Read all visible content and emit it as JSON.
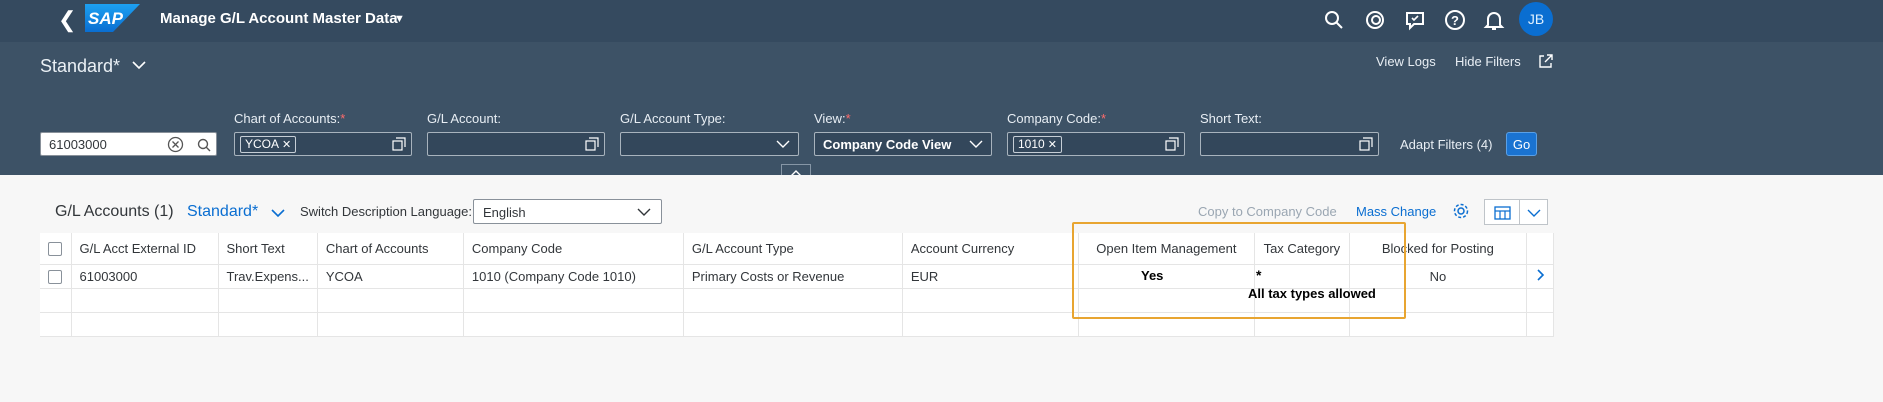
{
  "shell": {
    "title": "Manage G/L Account Master Data",
    "logo_text": "SAP",
    "avatar_initials": "JB",
    "icons": [
      "search-icon",
      "copilot-icon",
      "feedback-icon",
      "help-icon",
      "notification-icon"
    ]
  },
  "filterbar": {
    "variant": "Standard*",
    "view_logs": "View Logs",
    "hide_filters": "Hide Filters",
    "search_value": "61003000",
    "filters": {
      "chart_of_accounts": {
        "label": "Chart of Accounts:",
        "required": "*",
        "token": "YCOA"
      },
      "gl_account": {
        "label": "G/L Account:"
      },
      "gl_account_type": {
        "label": "G/L Account Type:"
      },
      "view": {
        "label": "View:",
        "required": "*",
        "value": "Company Code View"
      },
      "company_code": {
        "label": "Company Code:",
        "required": "*",
        "token": "1010"
      },
      "short_text": {
        "label": "Short Text:"
      }
    },
    "adapt_filters": "Adapt Filters (4)",
    "go": "Go"
  },
  "table_toolbar": {
    "title": "G/L Accounts (1)",
    "variant": "Standard*",
    "lang_label": "Switch Description Language:",
    "lang_value": "English",
    "copy_to_company_code": "Copy to Company Code",
    "mass_change": "Mass Change"
  },
  "table": {
    "columns": [
      "G/L Acct External ID",
      "Short Text",
      "Chart of Accounts",
      "Company Code",
      "G/L Account Type",
      "Account Currency",
      "Open Item Management",
      "Tax Category",
      "Blocked for Posting"
    ],
    "rows": [
      {
        "gl_acct_external_id": "61003000",
        "short_text": "Trav.Expens...",
        "chart_of_accounts": "YCOA",
        "company_code": "1010 (Company Code 1010)",
        "gl_account_type": "Primary Costs or Revenue",
        "account_currency": "EUR",
        "open_item_management": "Yes",
        "tax_category": "*",
        "tax_category_note": "All tax types allowed",
        "blocked_for_posting": "No"
      }
    ]
  },
  "colors": {
    "shell": "#354a5f",
    "filterbar": "#3d5266",
    "accent": "#0a6ed1",
    "highlight": "#e8a531"
  }
}
